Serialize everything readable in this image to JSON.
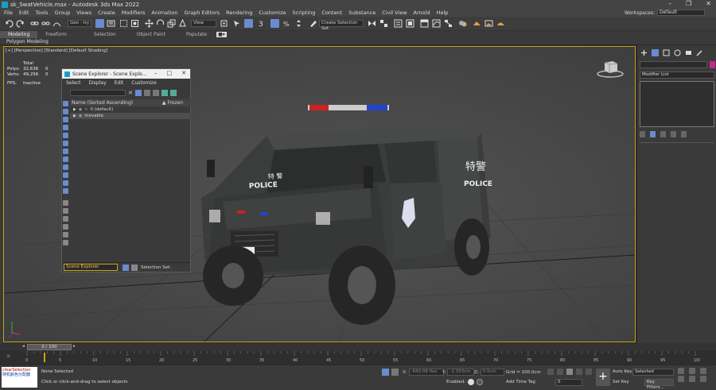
{
  "window": {
    "title": "sk_SwatVehicle.max - Autodesk 3ds Max 2022"
  },
  "menu": {
    "items": [
      "File",
      "Edit",
      "Tools",
      "Group",
      "Views",
      "Create",
      "Modifiers",
      "Animation",
      "Graph Editors",
      "Rendering",
      "Customize",
      "Scripting",
      "Content",
      "Substance",
      "Civil View",
      "Arnold",
      "Help"
    ]
  },
  "workspaces": {
    "label": "Workspaces:",
    "value": "Default"
  },
  "toolbar": {
    "geo_select": "Geo - try",
    "view_select": "View",
    "named_sel": "Create Selection Set"
  },
  "ribbon": {
    "tabs": [
      "Modeling",
      "Freeform",
      "Selection",
      "Object Paint",
      "Populate"
    ],
    "active": "Modeling",
    "sublabel": "Polygon Modeling"
  },
  "viewport": {
    "label": "[+] [Perspective] [Standard] [Default Shading]",
    "stats": {
      "header": "Total",
      "polys_label": "Polys:",
      "polys": "32,636",
      "polys_sel": "0",
      "verts_label": "Verts:",
      "verts": "49,256",
      "verts_sel": "0",
      "fps_label": "FPS:",
      "fps": "Inactive"
    }
  },
  "scene_explorer": {
    "title": "Scene Explorer - Scene Explo...",
    "menu": [
      "Select",
      "Display",
      "Edit",
      "Customize"
    ],
    "column": "Name (Sorted Ascending)",
    "frozen": "▲ Frozen",
    "rows": [
      {
        "label": "0 (default)"
      },
      {
        "label": "movable"
      }
    ],
    "footer_select": "Scene Explorer",
    "footer_text": "Selection Set:"
  },
  "command_panel": {
    "modifier_list": "Modifier List"
  },
  "timeline": {
    "frame": "0 / 100",
    "ticks": [
      "0",
      "5",
      "10",
      "15",
      "20",
      "25",
      "30",
      "35",
      "40",
      "45",
      "50",
      "55",
      "60",
      "65",
      "70",
      "75",
      "80",
      "85",
      "90",
      "95",
      "100"
    ]
  },
  "status": {
    "maxscript_1": "clearSelection",
    "maxscript_2": "随机颜色分配器",
    "none_selected": "None Selected",
    "hint": "Click or click-and-drag to select objects",
    "x_label": "X:",
    "x": "-643.06 flex",
    "y_label": "Y:",
    "y": "-1.333cm",
    "z_label": "Z:",
    "z": "0.0cm",
    "grid": "Grid = 100.0cm",
    "enabled": "Enabled:",
    "add_time_tag": "Add Time Tag",
    "frame_field": "0",
    "auto_key": "Auto Key",
    "selected": "Selected",
    "set_key": "Set Key",
    "key_filters": "Key Filters..."
  },
  "colors": {
    "accent": "#c8a214",
    "explorer_blue": "#1a9ec4"
  }
}
